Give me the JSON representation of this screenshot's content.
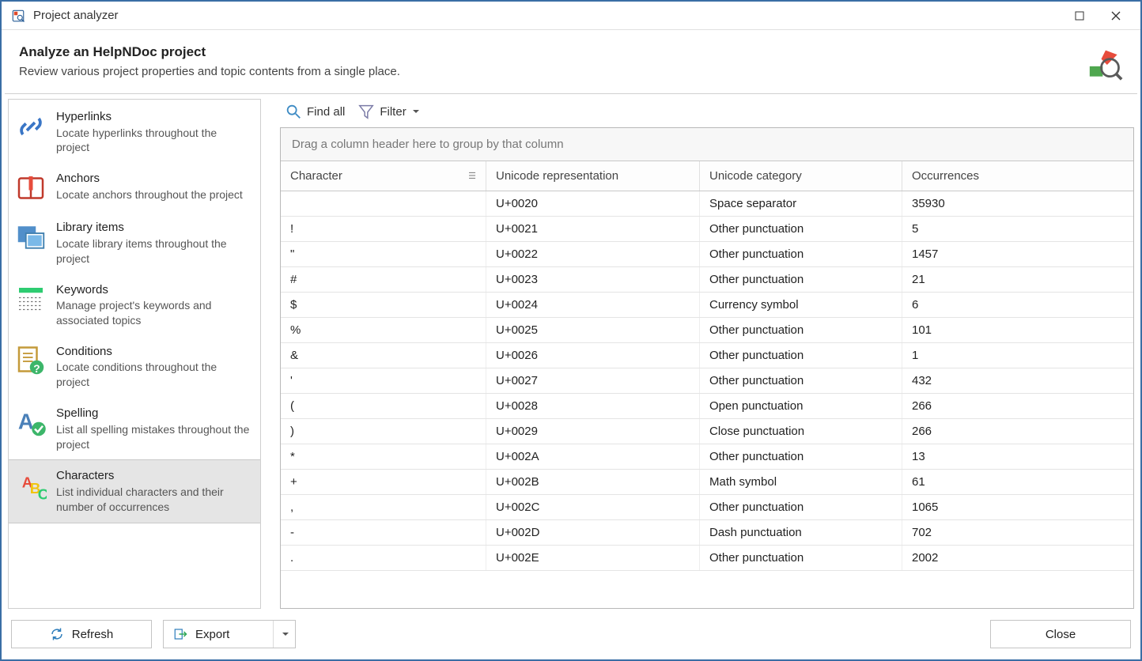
{
  "window": {
    "title": "Project analyzer"
  },
  "header": {
    "title": "Analyze an HelpNDoc project",
    "subtitle": "Review various project properties and topic contents from a single place."
  },
  "sidebar": {
    "items": [
      {
        "id": "hyperlinks",
        "title": "Hyperlinks",
        "desc": "Locate hyperlinks throughout the project"
      },
      {
        "id": "anchors",
        "title": "Anchors",
        "desc": "Locate anchors throughout the project"
      },
      {
        "id": "library",
        "title": "Library items",
        "desc": "Locate library items throughout the project"
      },
      {
        "id": "keywords",
        "title": "Keywords",
        "desc": "Manage project's keywords and associated topics"
      },
      {
        "id": "conditions",
        "title": "Conditions",
        "desc": "Locate conditions throughout the project"
      },
      {
        "id": "spelling",
        "title": "Spelling",
        "desc": "List all spelling mistakes throughout the project"
      },
      {
        "id": "characters",
        "title": "Characters",
        "desc": "List individual characters and their number of occurrences",
        "selected": true
      }
    ]
  },
  "toolbar": {
    "find_all": "Find all",
    "filter": "Filter"
  },
  "grid": {
    "group_hint": "Drag a column header here to group by that column",
    "columns": {
      "character": "Character",
      "unicode": "Unicode representation",
      "category": "Unicode category",
      "occurrences": "Occurrences"
    },
    "rows": [
      {
        "char": "",
        "unicode": "U+0020",
        "cat": "Space separator",
        "occ": "35930"
      },
      {
        "char": "!",
        "unicode": "U+0021",
        "cat": "Other punctuation",
        "occ": "5"
      },
      {
        "char": "\"",
        "unicode": "U+0022",
        "cat": "Other punctuation",
        "occ": "1457"
      },
      {
        "char": "#",
        "unicode": "U+0023",
        "cat": "Other punctuation",
        "occ": "21"
      },
      {
        "char": "$",
        "unicode": "U+0024",
        "cat": "Currency symbol",
        "occ": "6"
      },
      {
        "char": "%",
        "unicode": "U+0025",
        "cat": "Other punctuation",
        "occ": "101"
      },
      {
        "char": "&",
        "unicode": "U+0026",
        "cat": "Other punctuation",
        "occ": "1"
      },
      {
        "char": "'",
        "unicode": "U+0027",
        "cat": "Other punctuation",
        "occ": "432"
      },
      {
        "char": "(",
        "unicode": "U+0028",
        "cat": "Open punctuation",
        "occ": "266"
      },
      {
        "char": ")",
        "unicode": "U+0029",
        "cat": "Close punctuation",
        "occ": "266"
      },
      {
        "char": "*",
        "unicode": "U+002A",
        "cat": "Other punctuation",
        "occ": "13"
      },
      {
        "char": "+",
        "unicode": "U+002B",
        "cat": "Math symbol",
        "occ": "61"
      },
      {
        "char": ",",
        "unicode": "U+002C",
        "cat": "Other punctuation",
        "occ": "1065"
      },
      {
        "char": "-",
        "unicode": "U+002D",
        "cat": "Dash punctuation",
        "occ": "702"
      },
      {
        "char": ".",
        "unicode": "U+002E",
        "cat": "Other punctuation",
        "occ": "2002"
      }
    ]
  },
  "footer": {
    "refresh": "Refresh",
    "export": "Export",
    "close": "Close"
  }
}
